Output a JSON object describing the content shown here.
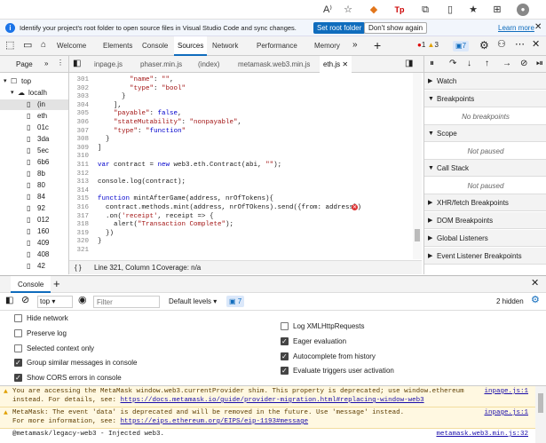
{
  "browser": {
    "icons": [
      "read-aloud-icon",
      "favorites-star-icon",
      "metamask-fox-icon",
      "extension-tp-icon",
      "extensions-puzzle-icon",
      "split-screen-icon",
      "favorites-icon",
      "collections-icon",
      "profile-icon"
    ]
  },
  "infobar": {
    "message": "Identify your project's root folder to open source files in Visual Studio Code and sync changes.",
    "set_root": "Set root folder",
    "dont_show": "Don't show again",
    "learn_more": "Learn more"
  },
  "devtools": {
    "tabs": [
      "Welcome",
      "Elements",
      "Console",
      "Sources",
      "Network",
      "Performance",
      "Memory"
    ],
    "active_tab": "Sources",
    "errors": "1",
    "warnings": "3",
    "messages": "7"
  },
  "navigator": {
    "tab": "Page",
    "items": [
      "top",
      "localh",
      "(in",
      "eth",
      "01c",
      "3da",
      "5ec",
      "6b6",
      "8b",
      "80",
      "84",
      "92",
      "012",
      "160",
      "409",
      "408",
      "42"
    ]
  },
  "file_tabs": [
    "inpage.js",
    "phaser.min.js",
    "(index)",
    "metamask.web3.min.js",
    "eth.js"
  ],
  "editor": {
    "lines": [
      {
        "n": "301",
        "t": "        \"name\": \"\","
      },
      {
        "n": "302",
        "t": "        \"type\": \"bool\""
      },
      {
        "n": "303",
        "t": "      }"
      },
      {
        "n": "304",
        "t": "    ],"
      },
      {
        "n": "305",
        "t": "    \"payable\": false,"
      },
      {
        "n": "306",
        "t": "    \"stateMutability\": \"nonpayable\","
      },
      {
        "n": "307",
        "t": "    \"type\": \"function\""
      },
      {
        "n": "308",
        "t": "  }"
      },
      {
        "n": "309",
        "t": "]"
      },
      {
        "n": "310",
        "t": ""
      },
      {
        "n": "311",
        "t": "var contract = new web3.eth.Contract(abi, \"\");"
      },
      {
        "n": "312",
        "t": ""
      },
      {
        "n": "313",
        "t": "console.log(contract);"
      },
      {
        "n": "314",
        "t": ""
      },
      {
        "n": "315",
        "t": "function mintAfterGame(address, nrOfTokens){"
      },
      {
        "n": "316",
        "t": "  contract.methods.mint(address, nrOfTOkens).send({from: address})"
      },
      {
        "n": "317",
        "t": "  .on('receipt', receipt => {"
      },
      {
        "n": "318",
        "t": "    alert(\"Transaction Complete\");"
      },
      {
        "n": "319",
        "t": "  })"
      },
      {
        "n": "320",
        "t": "}"
      },
      {
        "n": "321",
        "t": ""
      }
    ]
  },
  "status": {
    "braces": "{ }",
    "position": "Line 321, Column 1",
    "coverage": "Coverage: n/a"
  },
  "debugger": {
    "sections": [
      {
        "label": "Watch"
      },
      {
        "label": "Breakpoints",
        "empty": "No breakpoints"
      },
      {
        "label": "Scope",
        "empty": "Not paused"
      },
      {
        "label": "Call Stack",
        "empty": "Not paused"
      },
      {
        "label": "XHR/fetch Breakpoints"
      },
      {
        "label": "DOM Breakpoints"
      },
      {
        "label": "Global Listeners"
      },
      {
        "label": "Event Listener Breakpoints"
      }
    ]
  },
  "drawer": {
    "tab": "Console"
  },
  "console": {
    "context": "top",
    "filter_placeholder": "Filter",
    "levels": "Default levels",
    "msg_count": "7",
    "hidden": "2 hidden"
  },
  "settings": {
    "left": [
      {
        "label": "Hide network",
        "checked": false
      },
      {
        "label": "Preserve log",
        "checked": false
      },
      {
        "label": "Selected context only",
        "checked": false
      },
      {
        "label": "Group similar messages in console",
        "checked": true
      },
      {
        "label": "Show CORS errors in console",
        "checked": true
      }
    ],
    "right": [
      {
        "label": "Log XMLHttpRequests",
        "checked": false
      },
      {
        "label": "Eager evaluation",
        "checked": true
      },
      {
        "label": "Autocomplete from history",
        "checked": true
      },
      {
        "label": "Evaluate triggers user activation",
        "checked": true
      }
    ]
  },
  "messages": [
    {
      "type": "warn",
      "l1": "You are accessing the MetaMask window.web3.currentProvider shim. This property is deprecated; use window.ethereum",
      "l2a": "instead. For details, see: ",
      "l2b": "https://docs.metamask.io/guide/provider-migration.html#replacing-window-web3",
      "src": "inpage.js:1"
    },
    {
      "type": "warn",
      "l1": "MetaMask: The event 'data' is deprecated and will be removed in the future. Use 'message' instead.",
      "l2a": "For more information, see: ",
      "l2b": "https://eips.ethereum.org/EIPS/eip-1193#message",
      "src": "inpage.js:1"
    },
    {
      "type": "log",
      "l1": "@metamask/legacy-web3 - Injected web3.",
      "src": "metamask.web3.min.js:32"
    }
  ]
}
